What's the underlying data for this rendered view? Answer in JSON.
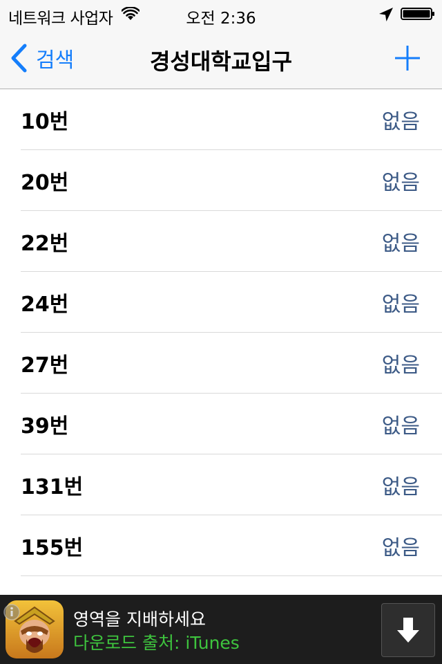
{
  "status_bar": {
    "carrier": "네트워크 사업자",
    "time": "오전 2:36",
    "wifi_icon": "wifi-icon",
    "location_icon": "location-arrow-icon",
    "battery_icon": "battery-icon"
  },
  "nav": {
    "back_label": "검색",
    "title": "경성대학교입구",
    "add_icon": "plus-icon",
    "accent_color": "#157efb"
  },
  "routes": [
    {
      "route": "10번",
      "status": "없음"
    },
    {
      "route": "20번",
      "status": "없음"
    },
    {
      "route": "22번",
      "status": "없음"
    },
    {
      "route": "24번",
      "status": "없음"
    },
    {
      "route": "27번",
      "status": "없음"
    },
    {
      "route": "39번",
      "status": "없음"
    },
    {
      "route": "131번",
      "status": "없음"
    },
    {
      "route": "155번",
      "status": "없음"
    }
  ],
  "ad": {
    "headline": "영역을 지배하세요",
    "source": "다운로드 출처: iTunes",
    "download_icon": "download-arrow-icon",
    "info_icon": "info-icon",
    "source_color": "#3ec43e"
  }
}
